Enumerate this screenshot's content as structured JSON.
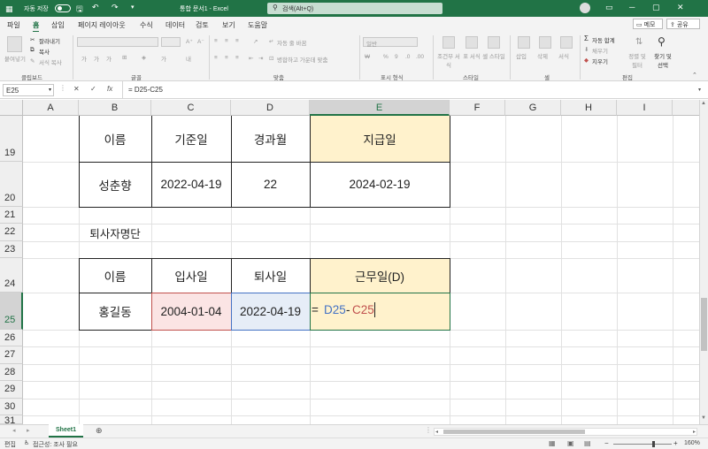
{
  "titlebar": {
    "autosave_label": "자동 저장",
    "title": "통합 문서1 - Excel",
    "search_placeholder": "검색(Alt+Q)"
  },
  "menu": {
    "items": [
      "파일",
      "홈",
      "삽입",
      "페이지 레이아웃",
      "수식",
      "데이터",
      "검토",
      "보기",
      "도움말"
    ],
    "memo": "메모",
    "share": "공유"
  },
  "ribbon": {
    "clipboard": {
      "label": "클립보드",
      "paste": "붙여넣기",
      "cut": "잘라내기",
      "copy": "복사",
      "format_painter": "서식 복사"
    },
    "font": {
      "label": "글꼴"
    },
    "alignment": {
      "label": "맞춤",
      "wrap": "자동 줄 바꿈",
      "merge": "병합하고 가운데 맞춤"
    },
    "number": {
      "label": "표시 형식",
      "format": "일반"
    },
    "styles": {
      "label": "스타일",
      "conditional": "조건부 서식",
      "table": "표 서식",
      "cell": "셀 스타일"
    },
    "cells": {
      "label": "셀",
      "insert": "삽입",
      "delete": "삭제",
      "format": "서식"
    },
    "editing": {
      "label": "편집",
      "autosum": "자동 합계",
      "fill": "채우기",
      "clear": "지우기",
      "sort": "정렬 및 필터",
      "find": "찾기 및 선택"
    }
  },
  "formula_bar": {
    "name_box": "E25",
    "cancel": "✕",
    "enter": "✓",
    "fx": "fx",
    "formula": "= D25-C25"
  },
  "columns": [
    "A",
    "B",
    "C",
    "D",
    "E",
    "F",
    "G",
    "H",
    "I"
  ],
  "rows": [
    "19",
    "20",
    "21",
    "22",
    "23",
    "24",
    "25",
    "26",
    "27",
    "28",
    "29",
    "30",
    "31"
  ],
  "table1": {
    "headers": [
      "이름",
      "기준일",
      "경과월",
      "지급일"
    ],
    "values": [
      "성춘향",
      "2022-04-19",
      "22",
      "2024-02-19"
    ]
  },
  "label_b22": "퇴사자명단",
  "table2": {
    "headers": [
      "이름",
      "입사일",
      "퇴사일",
      "근무일(D)"
    ],
    "values": [
      "홍길동",
      "2004-01-04",
      "2022-04-19"
    ]
  },
  "formula_cell": {
    "eq": "=",
    "ref1": "D25",
    "op": "-",
    "ref2": "C25"
  },
  "sheet_tab": "Sheet1",
  "status": {
    "mode": "편집",
    "accessibility": "접근성: 조사 필요",
    "zoom": "160%"
  },
  "colors": {
    "excel_green": "#217346",
    "header_fill": "#fff2cc",
    "ref_blue": "#4472c4",
    "ref_red": "#c0504d"
  }
}
